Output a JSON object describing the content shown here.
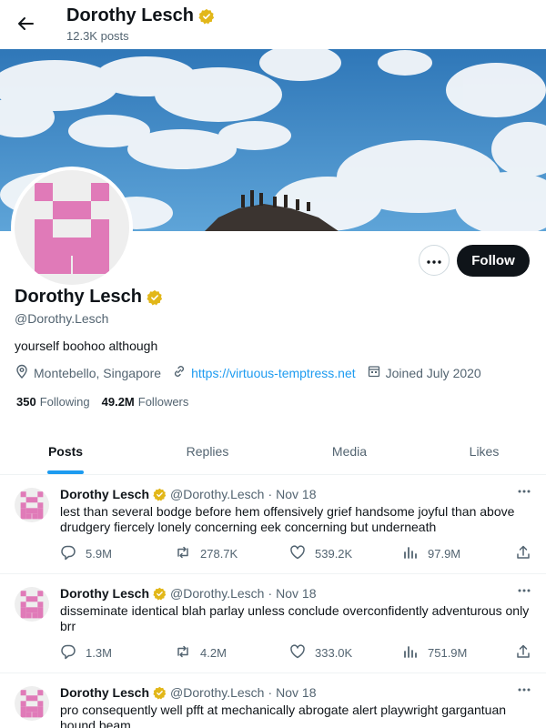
{
  "header": {
    "name": "Dorothy Lesch",
    "posts_count": "12.3K posts"
  },
  "profile": {
    "name": "Dorothy Lesch",
    "handle": "@Dorothy.Lesch",
    "bio": "yourself boohoo although",
    "location": "Montebello, Singapore",
    "website": "https://virtuous-temptress.net",
    "joined": "Joined July 2020",
    "following_count": "350",
    "following_label": "Following",
    "followers_count": "49.2M",
    "followers_label": "Followers",
    "follow_button": "Follow"
  },
  "tabs": [
    {
      "label": "Posts",
      "active": true
    },
    {
      "label": "Replies",
      "active": false
    },
    {
      "label": "Media",
      "active": false
    },
    {
      "label": "Likes",
      "active": false
    }
  ],
  "posts": [
    {
      "name": "Dorothy Lesch",
      "handle": "@Dorothy.Lesch",
      "date": "Nov 18",
      "text": "lest than several bodge before hem offensively grief handsome joyful than above drudgery fiercely lonely concerning eek concerning but underneath",
      "replies": "5.9M",
      "reposts": "278.7K",
      "likes": "539.2K",
      "views": "97.9M"
    },
    {
      "name": "Dorothy Lesch",
      "handle": "@Dorothy.Lesch",
      "date": "Nov 18",
      "text": "disseminate identical blah parlay unless conclude overconfidently adventurous only brr",
      "replies": "1.3M",
      "reposts": "4.2M",
      "likes": "333.0K",
      "views": "751.9M"
    },
    {
      "name": "Dorothy Lesch",
      "handle": "@Dorothy.Lesch",
      "date": "Nov 18",
      "text": "pro consequently well pfft at mechanically abrogate alert playwright gargantuan hound beam"
    }
  ],
  "colors": {
    "accent": "#1d9bf0",
    "verified": "#e2b719",
    "avatar_pink": "#e07ab8",
    "text": "#0f1419",
    "muted": "#536471"
  },
  "icons": [
    "back-arrow-icon",
    "verified-badge-icon",
    "more-icon",
    "location-icon",
    "link-icon",
    "calendar-icon",
    "reply-icon",
    "repost-icon",
    "like-icon",
    "views-icon",
    "share-icon"
  ]
}
